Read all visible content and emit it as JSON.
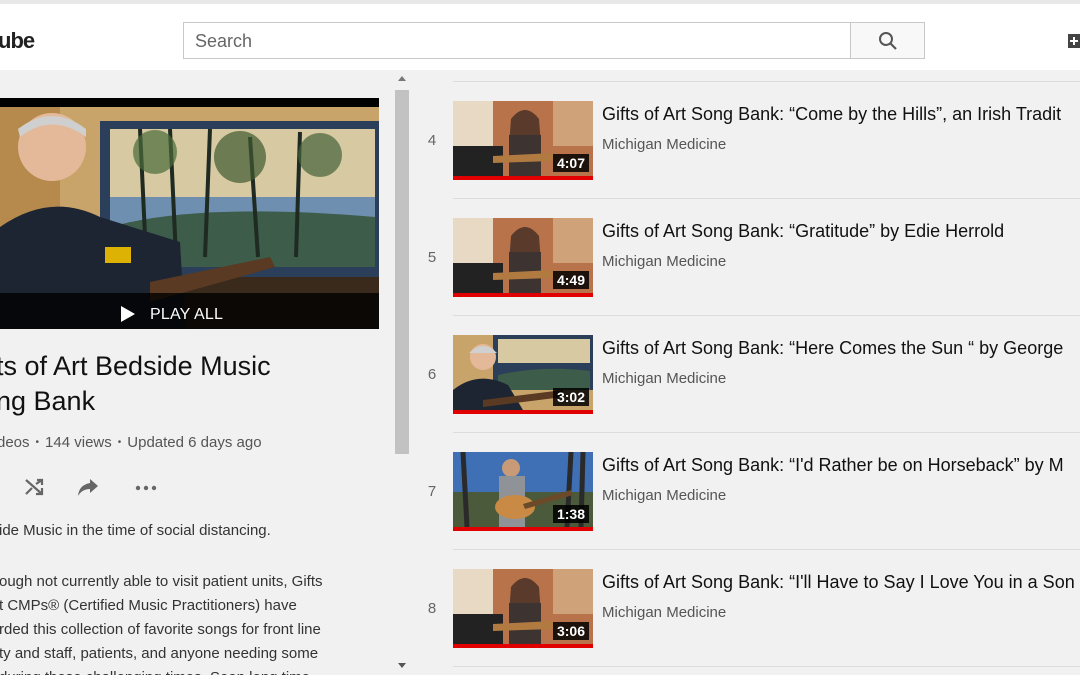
{
  "header": {
    "logo_fragment": "ube",
    "search_placeholder": "Search"
  },
  "playlist": {
    "play_all": "PLAY ALL",
    "title_line1": "ts of Art Bedside Music",
    "title_line2": "ng Bank",
    "videos_fragment": "deos",
    "views": "144 views",
    "updated": "Updated 6 days ago",
    "description_line1": "ide Music in the time of social distancing.",
    "description_body": [
      "ough not currently able to visit patient units, Gifts",
      "t CMPs® (Certified Music Practitioners) have",
      "rded this collection of favorite songs for front line",
      "ty and staff, patients, and anyone needing some",
      " during these challenging times.  Soon long time"
    ]
  },
  "videos": [
    {
      "index": "4",
      "title": "Gifts of Art Song Bank: “Come by the Hills”, an Irish Tradit",
      "channel": "Michigan Medicine",
      "duration": "4:07",
      "thumb": "woman-ukulele"
    },
    {
      "index": "5",
      "title": "Gifts of Art Song Bank: “Gratitude” by Edie Herrold",
      "channel": "Michigan Medicine",
      "duration": "4:49",
      "thumb": "woman-ukulele"
    },
    {
      "index": "6",
      "title": "Gifts of Art Song Bank: “Here Comes the Sun “ by George",
      "channel": "Michigan Medicine",
      "duration": "3:02",
      "thumb": "man-guitar-painting"
    },
    {
      "index": "7",
      "title": "Gifts of Art Song Bank: “I'd Rather be on Horseback” by M",
      "channel": "Michigan Medicine",
      "duration": "1:38",
      "thumb": "man-guitar-outdoor"
    },
    {
      "index": "8",
      "title": "Gifts of Art Song Bank: “I'll Have to Say I Love You in a Son",
      "channel": "Michigan Medicine",
      "duration": "3:06",
      "thumb": "woman-ukulele"
    }
  ],
  "colors": {
    "progress_red": "#e00000",
    "page_bg": "#f1f1f1"
  }
}
